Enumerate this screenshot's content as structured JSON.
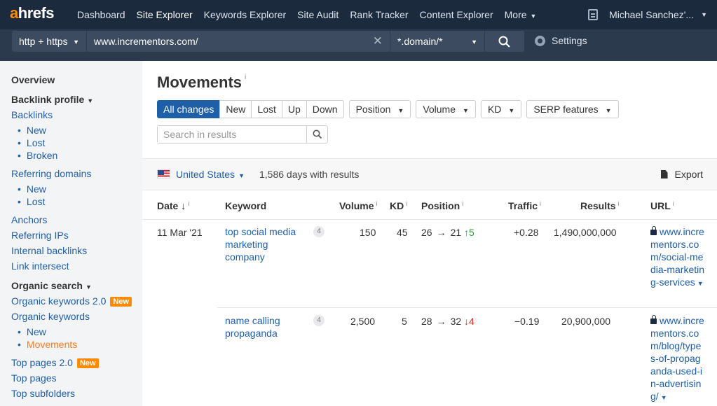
{
  "topnav": {
    "logo_a": "a",
    "logo_rest": "hrefs",
    "items": [
      {
        "label": "Dashboard"
      },
      {
        "label": "Site Explorer"
      },
      {
        "label": "Keywords Explorer"
      },
      {
        "label": "Site Audit"
      },
      {
        "label": "Rank Tracker"
      },
      {
        "label": "Content Explorer"
      },
      {
        "label": "More"
      }
    ],
    "user": "Michael Sanchez'..."
  },
  "searchbar": {
    "protocol": "http + https",
    "url": "www.incrementors.com/",
    "mode": "*.domain/*",
    "settings": "Settings"
  },
  "sidebar": {
    "overview": "Overview",
    "backlink_profile": "Backlink profile",
    "backlinks": "Backlinks",
    "backlinks_new": "New",
    "backlinks_lost": "Lost",
    "backlinks_broken": "Broken",
    "referring_domains": "Referring domains",
    "rd_new": "New",
    "rd_lost": "Lost",
    "anchors": "Anchors",
    "referring_ips": "Referring IPs",
    "internal_backlinks": "Internal backlinks",
    "link_intersect": "Link intersect",
    "organic_search": "Organic search",
    "organic_keywords_2": "Organic keywords 2.0",
    "organic_keywords": "Organic keywords",
    "ok_new": "New",
    "ok_movements": "Movements",
    "top_pages_2": "Top pages 2.0",
    "top_pages": "Top pages",
    "top_subfolders": "Top subfolders",
    "badge_new": "New"
  },
  "main": {
    "title": "Movements",
    "info": "i",
    "filters": {
      "all_changes": "All changes",
      "new": "New",
      "lost": "Lost",
      "up": "Up",
      "down": "Down",
      "position": "Position",
      "volume": "Volume",
      "kd": "KD",
      "serp_features": "SERP features"
    },
    "search_placeholder": "Search in results",
    "country": "United States",
    "days": "1,586 days with results",
    "export": "Export",
    "columns": {
      "date": "Date",
      "keyword": "Keyword",
      "volume": "Volume",
      "kd": "KD",
      "position": "Position",
      "traffic": "Traffic",
      "results": "Results",
      "url": "URL"
    },
    "rows": [
      {
        "date": "11 Mar '21",
        "keyword": "top social media marketing company",
        "serp": "4",
        "volume": "150",
        "kd": "45",
        "pos_from": "26",
        "pos_to": "21",
        "change": "↑5",
        "traffic": "+0.28",
        "results": "1,490,000,000",
        "url": "www.incrementors.com/social-media-marketing-services"
      },
      {
        "date": "",
        "keyword": "name calling propaganda",
        "serp": "4",
        "volume": "2,500",
        "kd": "5",
        "pos_from": "28",
        "pos_to": "32",
        "change": "↓4",
        "traffic": "−0.19",
        "results": "20,900,000",
        "url": "www.incrementors.com/blog/types-of-propaganda-used-in-advertising/"
      }
    ]
  },
  "colors": {
    "topbar": "#1b2a3d",
    "accent": "#1f5fa8",
    "orange": "#ff8a00",
    "up": "#2a9a3a",
    "down": "#dd3333"
  }
}
